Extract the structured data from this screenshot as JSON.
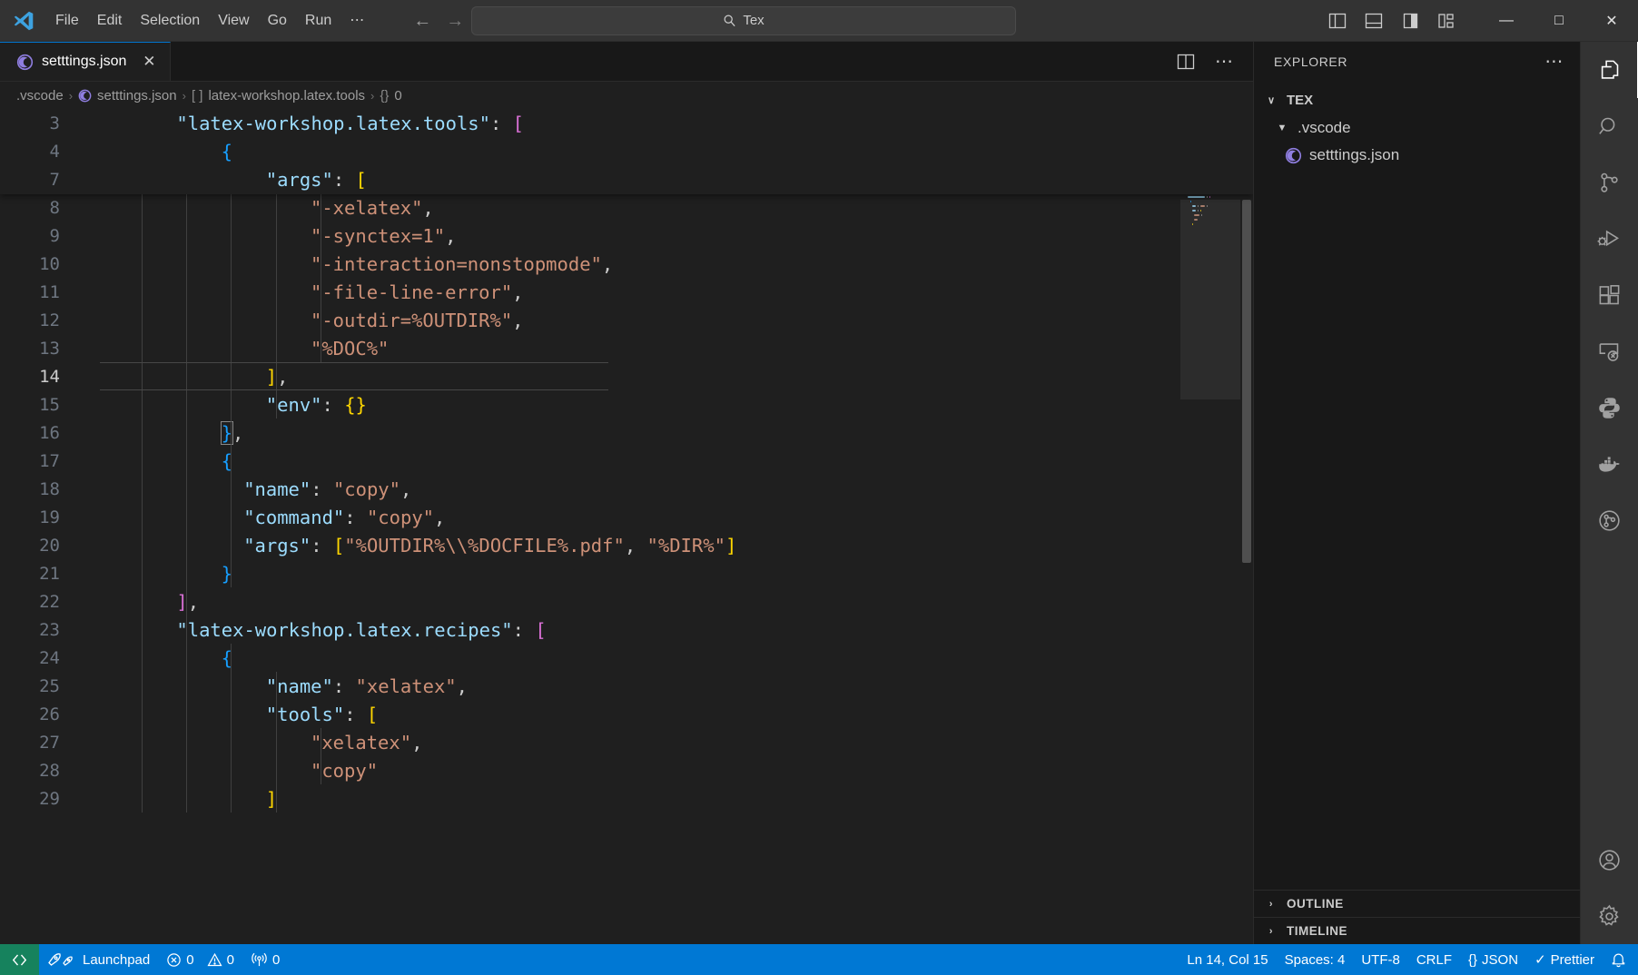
{
  "titlebar": {
    "logo_icon": "vscode-logo-icon",
    "menus": [
      "File",
      "Edit",
      "Selection",
      "View",
      "Go",
      "Run",
      "⋯"
    ],
    "nav_back_icon": "arrow-left-icon",
    "nav_forward_icon": "arrow-right-icon",
    "search": {
      "icon": "search-icon",
      "value": "Tex",
      "placeholder": "Search"
    },
    "layout_icons": [
      "toggle-primary-sidebar-icon",
      "toggle-panel-icon",
      "toggle-secondary-sidebar-icon",
      "customize-layout-icon"
    ],
    "window_controls": {
      "minimize": "—",
      "maximize": "□",
      "close": "✕"
    }
  },
  "tabs": {
    "items": [
      {
        "label": "setttings.json",
        "icon": "json-file-icon",
        "close": "✕",
        "active": true
      }
    ],
    "actions": [
      "split-editor-icon",
      "more-actions-icon"
    ]
  },
  "breadcrumbs": [
    {
      "label": ".vscode",
      "icon": ""
    },
    {
      "label": "setttings.json",
      "icon": "json-file-icon"
    },
    {
      "label": "latex-workshop.latex.tools",
      "icon": "array-symbol-icon"
    },
    {
      "label": "0",
      "icon": "object-symbol-icon"
    }
  ],
  "editor": {
    "sticky_lines": [
      {
        "num": "3",
        "indent": 2,
        "tokens": [
          {
            "t": "\"latex-workshop.latex.tools\"",
            "c": "t-key"
          },
          {
            "t": ": ",
            "c": "t-punc"
          },
          {
            "t": "[",
            "c": "b2"
          }
        ]
      },
      {
        "num": "4",
        "indent": 3,
        "tokens": [
          {
            "t": "{",
            "c": "b3"
          }
        ]
      },
      {
        "num": "7",
        "indent": 4,
        "tokens": [
          {
            "t": "\"args\"",
            "c": "t-key"
          },
          {
            "t": ": ",
            "c": "t-punc"
          },
          {
            "t": "[",
            "c": "b1"
          }
        ]
      }
    ],
    "lines": [
      {
        "num": "8",
        "indent": 5,
        "tokens": [
          {
            "t": "\"-xelatex\"",
            "c": "t-str"
          },
          {
            "t": ",",
            "c": "t-punc"
          }
        ]
      },
      {
        "num": "9",
        "indent": 5,
        "tokens": [
          {
            "t": "\"-synctex=1\"",
            "c": "t-str"
          },
          {
            "t": ",",
            "c": "t-punc"
          }
        ]
      },
      {
        "num": "10",
        "indent": 5,
        "tokens": [
          {
            "t": "\"-interaction=nonstopmode\"",
            "c": "t-str"
          },
          {
            "t": ",",
            "c": "t-punc"
          }
        ]
      },
      {
        "num": "11",
        "indent": 5,
        "tokens": [
          {
            "t": "\"-file-line-error\"",
            "c": "t-str"
          },
          {
            "t": ",",
            "c": "t-punc"
          }
        ]
      },
      {
        "num": "12",
        "indent": 5,
        "tokens": [
          {
            "t": "\"-outdir=%OUTDIR%\"",
            "c": "t-str"
          },
          {
            "t": ",",
            "c": "t-punc"
          }
        ]
      },
      {
        "num": "13",
        "indent": 5,
        "tokens": [
          {
            "t": "\"%DOC%\"",
            "c": "t-str"
          }
        ]
      },
      {
        "num": "14",
        "indent": 4,
        "active": true,
        "tokens": [
          {
            "t": "]",
            "c": "b1"
          },
          {
            "t": ",",
            "c": "t-punc"
          }
        ]
      },
      {
        "num": "15",
        "indent": 4,
        "tokens": [
          {
            "t": "\"env\"",
            "c": "t-key"
          },
          {
            "t": ": ",
            "c": "t-punc"
          },
          {
            "t": "{}",
            "c": "b1"
          }
        ]
      },
      {
        "num": "16",
        "indent": 3,
        "tokens": [
          {
            "t": "}",
            "c": "b3 bracket-box"
          },
          {
            "t": ",",
            "c": "t-punc"
          }
        ]
      },
      {
        "num": "17",
        "indent": 3,
        "tokens": [
          {
            "t": "{",
            "c": "b3"
          }
        ]
      },
      {
        "num": "18",
        "indent": 3.5,
        "tokens": [
          {
            "t": "\"name\"",
            "c": "t-key"
          },
          {
            "t": ": ",
            "c": "t-punc"
          },
          {
            "t": "\"copy\"",
            "c": "t-str"
          },
          {
            "t": ",",
            "c": "t-punc"
          }
        ]
      },
      {
        "num": "19",
        "indent": 3.5,
        "tokens": [
          {
            "t": "\"command\"",
            "c": "t-key"
          },
          {
            "t": ": ",
            "c": "t-punc"
          },
          {
            "t": "\"copy\"",
            "c": "t-str"
          },
          {
            "t": ",",
            "c": "t-punc"
          }
        ]
      },
      {
        "num": "20",
        "indent": 3.5,
        "tokens": [
          {
            "t": "\"args\"",
            "c": "t-key"
          },
          {
            "t": ": ",
            "c": "t-punc"
          },
          {
            "t": "[",
            "c": "b1"
          },
          {
            "t": "\"%OUTDIR%\\\\%DOCFILE%.pdf\"",
            "c": "t-str"
          },
          {
            "t": ", ",
            "c": "t-punc"
          },
          {
            "t": "\"%DIR%\"",
            "c": "t-str"
          },
          {
            "t": "]",
            "c": "b1"
          }
        ]
      },
      {
        "num": "21",
        "indent": 3,
        "tokens": [
          {
            "t": "}",
            "c": "b3"
          }
        ]
      },
      {
        "num": "22",
        "indent": 2,
        "tokens": [
          {
            "t": "]",
            "c": "b2"
          },
          {
            "t": ",",
            "c": "t-punc"
          }
        ]
      },
      {
        "num": "23",
        "indent": 2,
        "tokens": [
          {
            "t": "\"latex-workshop.latex.recipes\"",
            "c": "t-key"
          },
          {
            "t": ": ",
            "c": "t-punc"
          },
          {
            "t": "[",
            "c": "b2"
          }
        ]
      },
      {
        "num": "24",
        "indent": 3,
        "tokens": [
          {
            "t": "{",
            "c": "b3"
          }
        ]
      },
      {
        "num": "25",
        "indent": 4,
        "tokens": [
          {
            "t": "\"name\"",
            "c": "t-key"
          },
          {
            "t": ": ",
            "c": "t-punc"
          },
          {
            "t": "\"xelatex\"",
            "c": "t-str"
          },
          {
            "t": ",",
            "c": "t-punc"
          }
        ]
      },
      {
        "num": "26",
        "indent": 4,
        "tokens": [
          {
            "t": "\"tools\"",
            "c": "t-key"
          },
          {
            "t": ": ",
            "c": "t-punc"
          },
          {
            "t": "[",
            "c": "b1"
          }
        ]
      },
      {
        "num": "27",
        "indent": 5,
        "tokens": [
          {
            "t": "\"xelatex\"",
            "c": "t-str"
          },
          {
            "t": ",",
            "c": "t-punc"
          }
        ]
      },
      {
        "num": "28",
        "indent": 5,
        "tokens": [
          {
            "t": "\"copy\"",
            "c": "t-str"
          }
        ]
      },
      {
        "num": "29",
        "indent": 4,
        "tokens": [
          {
            "t": "]",
            "c": "b1"
          }
        ]
      }
    ]
  },
  "sidebar": {
    "title": "EXPLORER",
    "more_icon": "more-actions-icon",
    "root": {
      "label": "TEX",
      "twisty": "∨"
    },
    "tree": [
      {
        "label": ".vscode",
        "level": 1,
        "twisty": "▼",
        "icon": "folder-icon"
      },
      {
        "label": "setttings.json",
        "level": 2,
        "twisty": "",
        "icon": "json-file-icon"
      }
    ],
    "sections": [
      {
        "label": "OUTLINE",
        "twisty": "›"
      },
      {
        "label": "TIMELINE",
        "twisty": "›"
      }
    ]
  },
  "activitybar": {
    "items": [
      {
        "name": "explorer-icon",
        "active": true
      },
      {
        "name": "search-icon",
        "active": false
      },
      {
        "name": "source-control-icon",
        "active": false
      },
      {
        "name": "run-and-debug-icon",
        "active": false
      },
      {
        "name": "extensions-icon",
        "active": false
      },
      {
        "name": "remote-explorer-icon",
        "active": false
      },
      {
        "name": "python-icon",
        "active": false
      },
      {
        "name": "docker-icon",
        "active": false
      },
      {
        "name": "testing-icon",
        "active": false
      }
    ],
    "bottom": [
      {
        "name": "account-icon"
      },
      {
        "name": "manage-settings-gear-icon"
      }
    ]
  },
  "statusbar": {
    "remote_icon": "remote-window-icon",
    "launchpad": {
      "label": "Launchpad",
      "icon": "rocket-icon"
    },
    "errors": {
      "icon": "error-icon",
      "count": "0"
    },
    "warnings": {
      "icon": "warning-icon",
      "count": "0"
    },
    "ports": {
      "icon": "radio-tower-icon",
      "count": "0"
    },
    "cursor": "Ln 14, Col 15",
    "indentation": "Spaces: 4",
    "encoding": "UTF-8",
    "eol": "CRLF",
    "language": {
      "label": "JSON",
      "icon": "braces-icon"
    },
    "formatter": {
      "label": "Prettier",
      "icon": "check-icon"
    },
    "bell_icon": "notifications-bell-icon"
  },
  "colors": {
    "accent": "#0078d4",
    "remote_green": "#16825d",
    "titlebar_bg": "#333333",
    "editor_bg": "#1f1f1f",
    "sidebar_bg": "#181818",
    "string": "#ce9178",
    "key": "#9cdcfe",
    "bracket1": "#ffd700",
    "bracket2": "#da70d6",
    "bracket3": "#179fff",
    "json_icon": "#8f7ee0"
  }
}
